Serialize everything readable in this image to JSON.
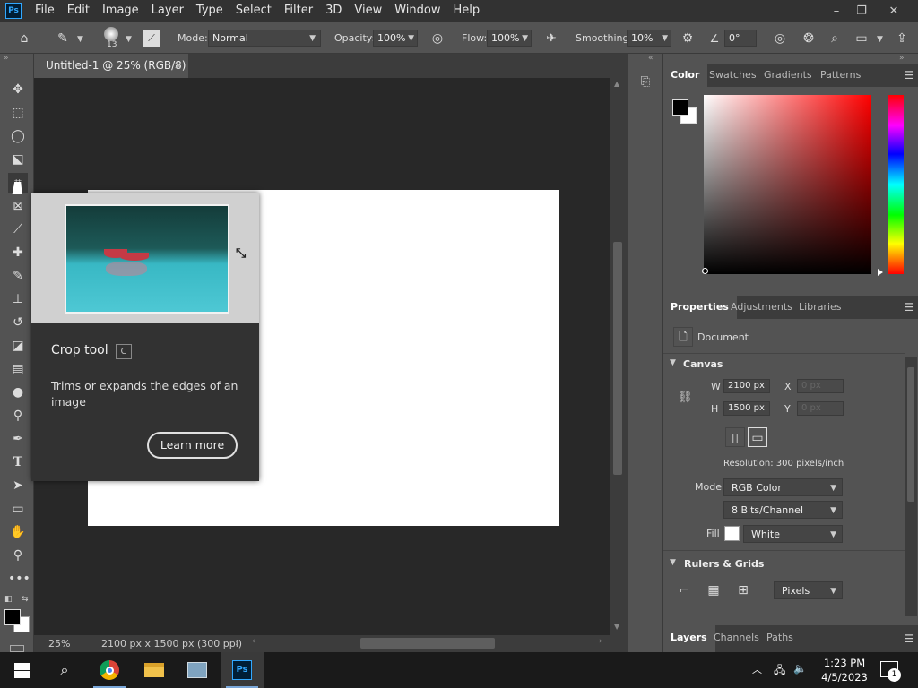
{
  "app": {
    "logo": "Ps",
    "menu": [
      "File",
      "Edit",
      "Image",
      "Layer",
      "Type",
      "Select",
      "Filter",
      "3D",
      "View",
      "Window",
      "Help"
    ],
    "window_controls": [
      "–",
      "❐",
      "✕"
    ]
  },
  "options": {
    "brush_size": "13",
    "mode_label": "Mode:",
    "mode_value": "Normal",
    "opacity_label": "Opacity:",
    "opacity_value": "100%",
    "flow_label": "Flow:",
    "flow_value": "100%",
    "smoothing_label": "Smoothing:",
    "smoothing_value": "10%",
    "angle_value": "0°"
  },
  "document": {
    "tab_title": "Untitled-1 @ 25% (RGB/8)",
    "zoom": "25%",
    "info": "2100 px x 1500 px (300 ppi)"
  },
  "tooltip": {
    "title": "Crop tool",
    "shortcut": "C",
    "description": "Trims or expands the edges of an image",
    "button": "Learn more"
  },
  "color_panel": {
    "tabs": [
      "Color",
      "Swatches",
      "Gradients",
      "Patterns"
    ],
    "colors": {
      "foreground": "#000000",
      "background": "#ffffff"
    }
  },
  "properties_panel": {
    "tabs": [
      "Properties",
      "Adjustments",
      "Libraries"
    ],
    "doc_label": "Document",
    "canvas_title": "Canvas",
    "w_label": "W",
    "w_value": "2100 px",
    "h_label": "H",
    "h_value": "1500 px",
    "x_label": "X",
    "x_value": "0 px",
    "y_label": "Y",
    "y_value": "0 px",
    "resolution": "Resolution: 300 pixels/inch",
    "mode_label": "Mode",
    "mode_value": "RGB Color",
    "bits_value": "8 Bits/Channel",
    "fill_label": "Fill",
    "fill_value": "White",
    "rulers_title": "Rulers & Grids",
    "units_value": "Pixels"
  },
  "layers_panel": {
    "tabs": [
      "Layers",
      "Channels",
      "Paths"
    ]
  },
  "taskbar": {
    "time": "1:23 PM",
    "date": "4/5/2023",
    "notification_count": "1",
    "app_ps_label": "Ps"
  }
}
